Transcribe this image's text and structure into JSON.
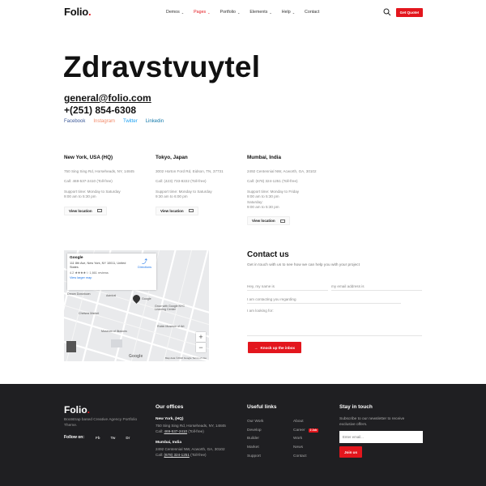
{
  "header": {
    "logo_text": "Folio",
    "logo_dot": ".",
    "nav": [
      {
        "label": "Demos",
        "caret": "⌄"
      },
      {
        "label": "Pages",
        "caret": "⌄"
      },
      {
        "label": "Portfolio",
        "caret": "⌄"
      },
      {
        "label": "Elements",
        "caret": "⌄"
      },
      {
        "label": "Help",
        "caret": "⌄"
      },
      {
        "label": "Contact",
        "caret": ""
      }
    ],
    "active_nav": "Pages",
    "quote_label": "Get Quote!"
  },
  "hero": {
    "title": "Zdravstvuytel",
    "email": "general@folio.com",
    "phone": "+(251) 854-6308",
    "socials": [
      {
        "label": "Facebook",
        "color": "#3b5998"
      },
      {
        "label": "Instagram",
        "color": "#f28b6b"
      },
      {
        "label": "Twitter",
        "color": "#1da1f2"
      },
      {
        "label": "Linkedin",
        "color": "#0e76a8"
      }
    ]
  },
  "offices": [
    {
      "title": "New York, USA (HQ)",
      "address": "750 Sing Sing Rd, Horseheads, NY, 14845",
      "call": "Call: 469-537-2410 (Toll-free)",
      "support": "Support time: Monday to Saturday",
      "hours": [
        "9:00 am to 5:30 pm"
      ],
      "button": "View location"
    },
    {
      "title": "Tokyo, Japan",
      "address": "3002 Horton Ford Rd, Eidson, TN, 37731",
      "call": "Call: (423) 733-8222 (Toll-free)",
      "support": "Support time: Monday to Saturday",
      "hours": [
        "9:30 am to 6:00 pm"
      ],
      "button": "View location"
    },
    {
      "title": "Mumbai, India",
      "address": "2492 Centennial NW, Acworth, GA, 30102",
      "call": "Call: (678) 324-1251 (Toll-free)",
      "support": "Support time: Monday to Friday",
      "hours": [
        "9:00 am to 5:30 pm",
        "Saturday:",
        "9:00 am to 5:30 pm"
      ],
      "button": "View location"
    }
  ],
  "map": {
    "place": "Google",
    "address": "111 8th Ave, New York, NY 10011, United States",
    "rating": "4.2 ★★★★☆  1,661 reviews",
    "larger_map": "View larger map",
    "directions": "Directions",
    "zoom_in": "+",
    "zoom_out": "−",
    "labels": [
      "Google",
      "Admiral",
      "Grow with Google NYC Learning Center",
      "Rubin Museum of Art",
      "Museum of Illusions",
      "Chelsea Market",
      "Dream Downtown"
    ],
    "footer": "Map data ©2022 Google   Terms of Use",
    "google_mark": "Google"
  },
  "contact": {
    "title": "Contact us",
    "subtitle": "Get in touch with us to see how we can help you with your project",
    "name_placeholder": "Hey, my name is",
    "email_placeholder": "my email address is",
    "regarding_placeholder": "I am contacting you regarding",
    "looking_placeholder": "I am looking for:",
    "send_label": "Knock up the inbox"
  },
  "footer": {
    "logo_text": "Folio",
    "logo_dot": ".",
    "description": "Bootstrap based Creative Agency Portfolio Theme.",
    "follow_label": "Follow on:",
    "social_short": [
      "Fb",
      "Tw",
      "Dr"
    ],
    "offices_heading": "Our offices",
    "offices": [
      {
        "name": "New York, (HQ)",
        "address": "750 Sing Sing Rd, Horseheads, NY, 14845",
        "call_prefix": "Call: ",
        "call_number": "469-537-2410",
        "call_suffix": " (Toll-free)"
      },
      {
        "name": "Mumbai, India",
        "address": "2492 Centennial NW, Acworth, GA, 30102",
        "call_prefix": "Call: ",
        "call_number": "(678) 324-1251",
        "call_suffix": " (Toll-free)"
      }
    ],
    "links_heading": "Useful links",
    "links_col1": [
      "Our Work",
      "Develop",
      "Builder",
      "Market",
      "Support"
    ],
    "links_col2": [
      "About",
      "Career",
      "Work",
      "News",
      "Contact"
    ],
    "career_badge": "2 Job",
    "stay_heading": "Stay in touch",
    "stay_desc": "Subscribe to our newsletter to receive exclusive offers.",
    "email_placeholder": "Enter email...",
    "join_label": "Join us"
  },
  "colors": {
    "accent": "#e3161d",
    "footer_bg": "#1f1f22"
  }
}
